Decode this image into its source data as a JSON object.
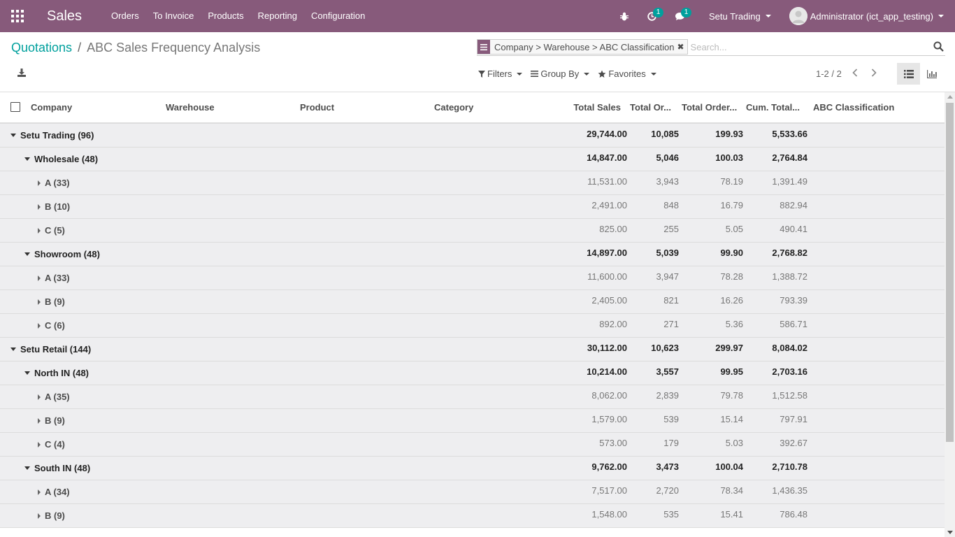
{
  "navbar": {
    "brand": "Sales",
    "menu": [
      "Orders",
      "To Invoice",
      "Products",
      "Reporting",
      "Configuration"
    ],
    "activity_count": "1",
    "message_count": "1",
    "company": "Setu Trading",
    "user": "Administrator (ict_app_testing)"
  },
  "breadcrumb": {
    "parent": "Quotations",
    "separator": "/",
    "current": "ABC Sales Frequency Analysis"
  },
  "search": {
    "facet": "Company > Warehouse > ABC Classification",
    "facet_remove": "✖",
    "placeholder": "Search..."
  },
  "filters": {
    "filters": "Filters",
    "group_by": "Group By",
    "favorites": "Favorites"
  },
  "pager": {
    "value": "1-2 / 2"
  },
  "table": {
    "headers": {
      "company": "Company",
      "warehouse": "Warehouse",
      "product": "Product",
      "category": "Category",
      "total_sales": "Total Sales",
      "total_orders": "Total Or...",
      "total_order_pct": "Total Order...",
      "cum_total": "Cum. Total...",
      "abc": "ABC Classification"
    },
    "rows": [
      {
        "level": 0,
        "expanded": true,
        "label": "Setu Trading (96)",
        "sales": "29,744.00",
        "orders": "10,085",
        "avg": "199.93",
        "cum": "5,533.66"
      },
      {
        "level": 1,
        "expanded": true,
        "label": "Wholesale (48)",
        "sales": "14,847.00",
        "orders": "5,046",
        "avg": "100.03",
        "cum": "2,764.84"
      },
      {
        "level": 2,
        "expanded": false,
        "label": "A (33)",
        "sales": "11,531.00",
        "orders": "3,943",
        "avg": "78.19",
        "cum": "1,391.49"
      },
      {
        "level": 2,
        "expanded": false,
        "label": "B (10)",
        "sales": "2,491.00",
        "orders": "848",
        "avg": "16.79",
        "cum": "882.94"
      },
      {
        "level": 2,
        "expanded": false,
        "label": "C (5)",
        "sales": "825.00",
        "orders": "255",
        "avg": "5.05",
        "cum": "490.41"
      },
      {
        "level": 1,
        "expanded": true,
        "label": "Showroom (48)",
        "sales": "14,897.00",
        "orders": "5,039",
        "avg": "99.90",
        "cum": "2,768.82"
      },
      {
        "level": 2,
        "expanded": false,
        "label": "A (33)",
        "sales": "11,600.00",
        "orders": "3,947",
        "avg": "78.28",
        "cum": "1,388.72"
      },
      {
        "level": 2,
        "expanded": false,
        "label": "B (9)",
        "sales": "2,405.00",
        "orders": "821",
        "avg": "16.26",
        "cum": "793.39"
      },
      {
        "level": 2,
        "expanded": false,
        "label": "C (6)",
        "sales": "892.00",
        "orders": "271",
        "avg": "5.36",
        "cum": "586.71"
      },
      {
        "level": 0,
        "expanded": true,
        "label": "Setu Retail (144)",
        "sales": "30,112.00",
        "orders": "10,623",
        "avg": "299.97",
        "cum": "8,084.02"
      },
      {
        "level": 1,
        "expanded": true,
        "label": "North IN (48)",
        "sales": "10,214.00",
        "orders": "3,557",
        "avg": "99.95",
        "cum": "2,703.16"
      },
      {
        "level": 2,
        "expanded": false,
        "label": "A (35)",
        "sales": "8,062.00",
        "orders": "2,839",
        "avg": "79.78",
        "cum": "1,512.58"
      },
      {
        "level": 2,
        "expanded": false,
        "label": "B (9)",
        "sales": "1,579.00",
        "orders": "539",
        "avg": "15.14",
        "cum": "797.91"
      },
      {
        "level": 2,
        "expanded": false,
        "label": "C (4)",
        "sales": "573.00",
        "orders": "179",
        "avg": "5.03",
        "cum": "392.67"
      },
      {
        "level": 1,
        "expanded": true,
        "label": "South IN (48)",
        "sales": "9,762.00",
        "orders": "3,473",
        "avg": "100.04",
        "cum": "2,710.78"
      },
      {
        "level": 2,
        "expanded": false,
        "label": "A (34)",
        "sales": "7,517.00",
        "orders": "2,720",
        "avg": "78.34",
        "cum": "1,436.35"
      },
      {
        "level": 2,
        "expanded": false,
        "label": "B (9)",
        "sales": "1,548.00",
        "orders": "535",
        "avg": "15.41",
        "cum": "786.48"
      }
    ]
  },
  "colors": {
    "navbar": "#875a7b",
    "link": "#00a09d",
    "badge": "#00a09d",
    "row_bg": "#eeeef0"
  },
  "icons": [
    "apps-icon",
    "bug-icon",
    "clock-icon",
    "chat-icon",
    "download-icon",
    "filter-icon",
    "group-by-icon",
    "star-icon",
    "search-icon",
    "list-view-icon",
    "graph-view-icon"
  ]
}
